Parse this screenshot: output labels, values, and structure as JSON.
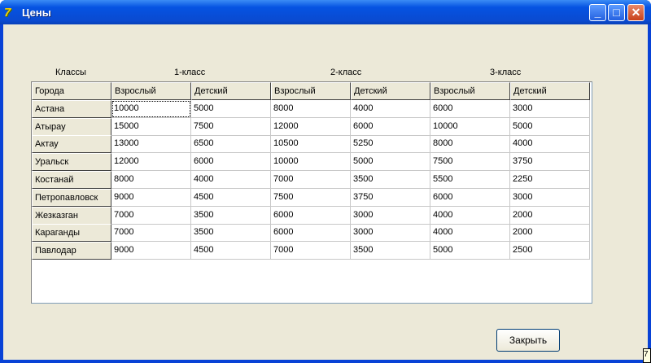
{
  "window": {
    "title": "Цены",
    "app_icon": "delphi-icon"
  },
  "labels": {
    "classes": "Классы",
    "class1": "1-класс",
    "class2": "2-класс",
    "class3": "3-класс"
  },
  "table": {
    "headers": [
      "Города",
      "Взрослый",
      "Детский",
      "Взрослый",
      "Детский",
      "Взрослый",
      "Детский"
    ],
    "rows": [
      [
        "Астана",
        "10000",
        "5000",
        "8000",
        "4000",
        "6000",
        "3000"
      ],
      [
        "Атырау",
        "15000",
        "7500",
        "12000",
        "6000",
        "10000",
        "5000"
      ],
      [
        "Актау",
        "13000",
        "6500",
        "10500",
        "5250",
        "8000",
        "4000"
      ],
      [
        "Уральск",
        "12000",
        "6000",
        "10000",
        "5000",
        "7500",
        "3750"
      ],
      [
        "Костанай",
        "8000",
        "4000",
        "7000",
        "3500",
        "5500",
        "2250"
      ],
      [
        "Петропавловск",
        "9000",
        "4500",
        "7500",
        "3750",
        "6000",
        "3000"
      ],
      [
        "Жезказган",
        "7000",
        "3500",
        "6000",
        "3000",
        "4000",
        "2000"
      ],
      [
        "Караганды",
        "7000",
        "3500",
        "6000",
        "3000",
        "4000",
        "2000"
      ],
      [
        "Павлодар",
        "9000",
        "4500",
        "7000",
        "3500",
        "5000",
        "2500"
      ]
    ]
  },
  "buttons": {
    "close": "Закрыть"
  },
  "grip": "7"
}
